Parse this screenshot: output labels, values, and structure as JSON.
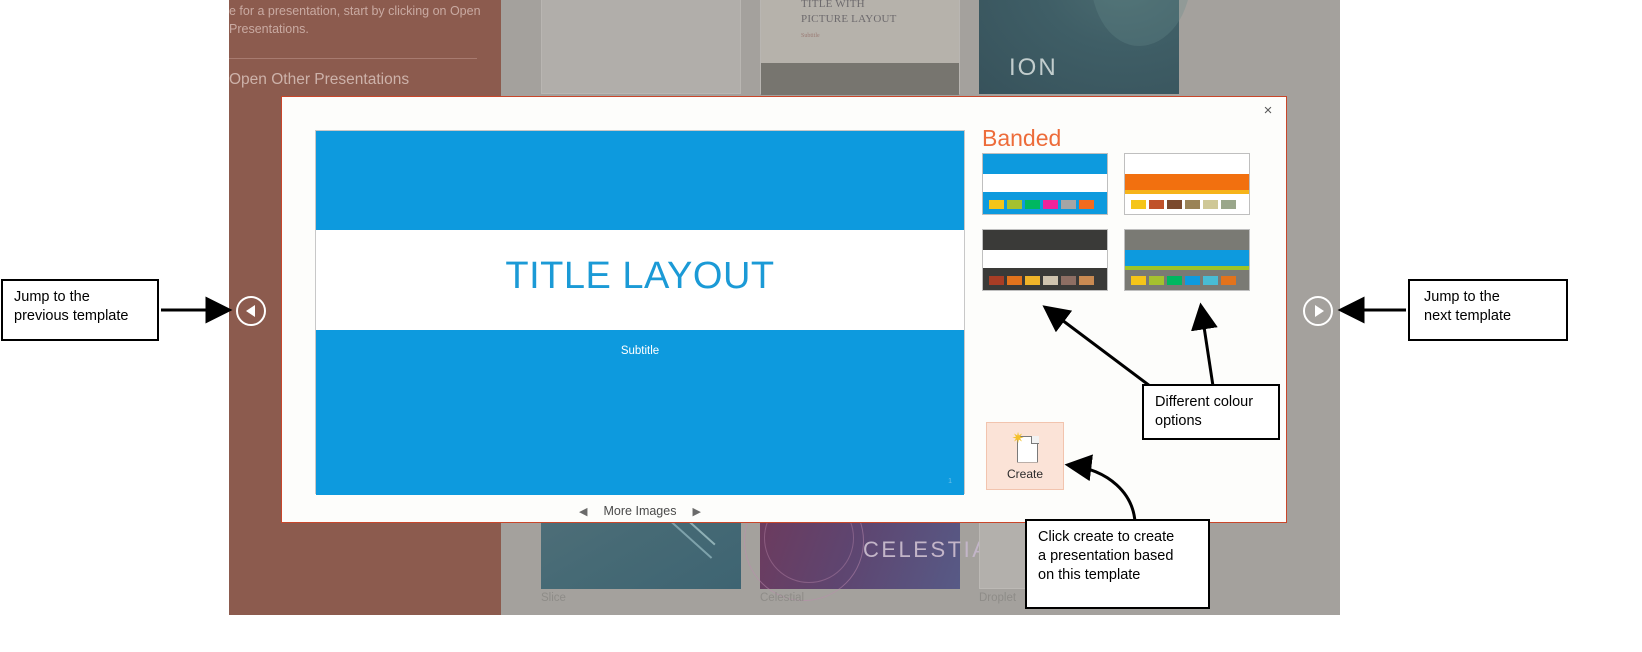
{
  "background": {
    "left_pane": {
      "intro_text": "e for a presentation, start by clicking on Open\nPresentations.",
      "open_other_heading": "Open Other Presentations"
    },
    "thumbnails": [
      {
        "name": "blank-presentation",
        "label": ""
      },
      {
        "name": "title-with-picture-layout",
        "title": "TITLE WITH\nPICTURE LAYOUT",
        "subtitle": "Subtitle"
      },
      {
        "name": "ion",
        "label": "ION"
      },
      {
        "name": "slice",
        "label": "Slice"
      },
      {
        "name": "celestial",
        "label": "CELESTIAL",
        "caption": "Celestial"
      },
      {
        "name": "droplet",
        "label": "Droplet"
      }
    ]
  },
  "dialog": {
    "close_label": "×",
    "template_name": "Banded",
    "slide": {
      "title": "TITLE LAYOUT",
      "subtitle": "Subtitle",
      "page_number": "1"
    },
    "more_images": {
      "prev_arrow": "◀",
      "label": "More Images",
      "next_arrow": "▶"
    },
    "create": {
      "label": "Create",
      "icon": "new-document-icon"
    },
    "variants": [
      {
        "name": "banded-blue",
        "band_top": "#0d9ade",
        "band_mid": "#ffffff",
        "band_bottom": "#0d9ade",
        "accent_line": "",
        "chips": [
          "#f5c518",
          "#a5c12f",
          "#00b760",
          "#f0239b",
          "#a5a5a5",
          "#f26b1d"
        ]
      },
      {
        "name": "banded-orange",
        "band_top": "#ffffff",
        "band_mid": "#f2700f",
        "band_bottom": "#ffffff",
        "accent_line": "#f6b41a",
        "chips": [
          "#f5c518",
          "#c0522a",
          "#7b4a2e",
          "#9a8357",
          "#cfc896",
          "#9aa78b"
        ]
      },
      {
        "name": "banded-dark",
        "band_top": "#3a3a38",
        "band_mid": "#ffffff",
        "band_bottom": "#3a3a38",
        "accent_line": "",
        "chips": [
          "#a83d25",
          "#e2731c",
          "#f0b429",
          "#cfc3ae",
          "#8d6e63",
          "#c98a52"
        ]
      },
      {
        "name": "banded-grey-blue",
        "band_top": "#7a7a74",
        "band_mid": "#0d9ade",
        "band_bottom": "#7a7a74",
        "accent_line": "#9dc328",
        "chips": [
          "#f5c518",
          "#a5c12f",
          "#00b760",
          "#0d9ade",
          "#49bcd4",
          "#e2731c"
        ]
      }
    ]
  },
  "navigation": {
    "prev_button_icon": "triangle-left-icon",
    "next_button_icon": "triangle-right-icon"
  },
  "annotations": {
    "prev_template": "Jump to the\nprevious template",
    "next_template": "Jump to the\nnext template",
    "colour_options": "Different colour\noptions",
    "create_note": "Click create to create\na presentation based\non this template"
  },
  "colors": {
    "accent_blue": "#0d9ade",
    "brand_orange": "#ed6c3a",
    "dialog_border": "#c9462a",
    "create_bg": "#fbe3d7"
  }
}
